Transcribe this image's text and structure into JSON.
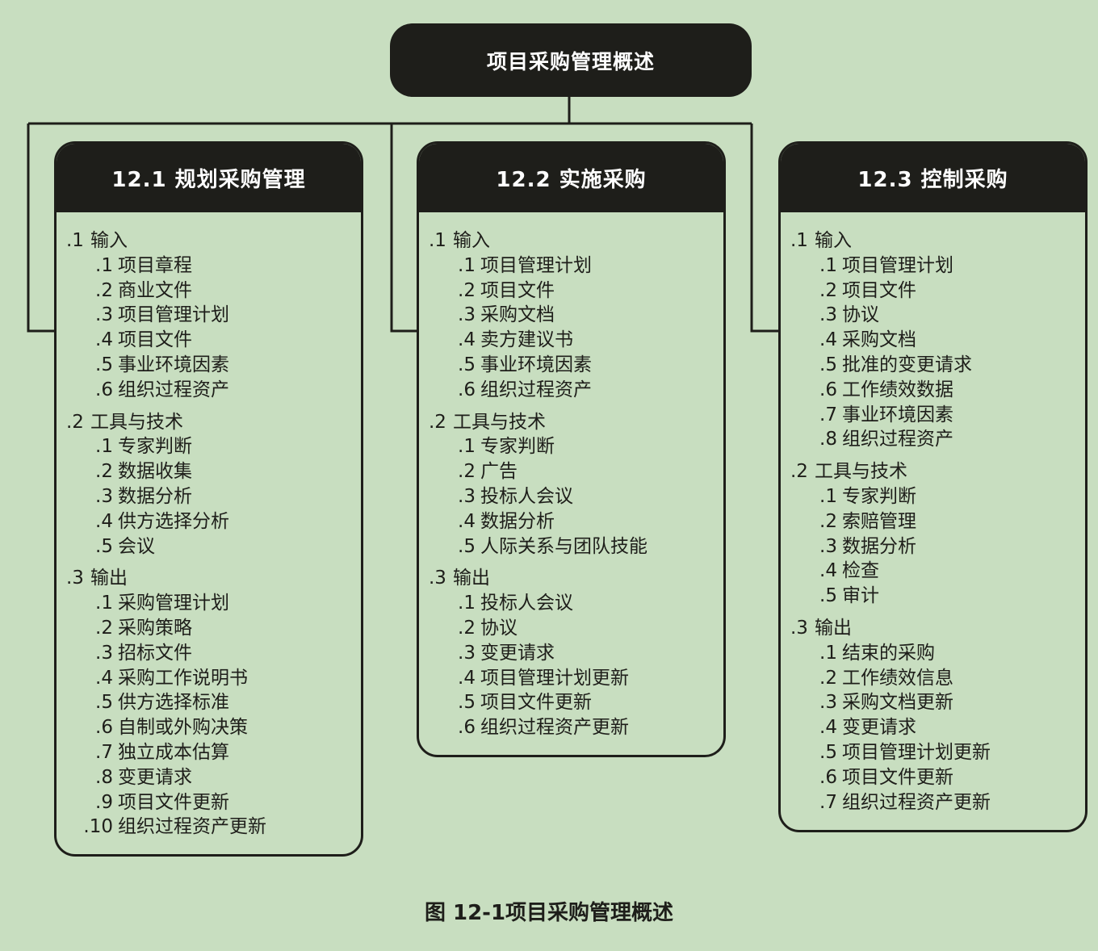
{
  "overview_title": "项目采购管理概述",
  "caption": "图 12-1项目采购管理概述",
  "processes": [
    {
      "title": "12.1 规划采购管理",
      "groups": [
        {
          "num": ".1",
          "label": "输入",
          "items": [
            {
              "num": ".1",
              "label": "项目章程"
            },
            {
              "num": ".2",
              "label": "商业文件"
            },
            {
              "num": ".3",
              "label": "项目管理计划"
            },
            {
              "num": ".4",
              "label": "项目文件"
            },
            {
              "num": ".5",
              "label": "事业环境因素"
            },
            {
              "num": ".6",
              "label": "组织过程资产"
            }
          ]
        },
        {
          "num": ".2",
          "label": "工具与技术",
          "items": [
            {
              "num": ".1",
              "label": "专家判断"
            },
            {
              "num": ".2",
              "label": "数据收集"
            },
            {
              "num": ".3",
              "label": "数据分析"
            },
            {
              "num": ".4",
              "label": "供方选择分析"
            },
            {
              "num": ".5",
              "label": "会议"
            }
          ]
        },
        {
          "num": ".3",
          "label": "输出",
          "items": [
            {
              "num": ".1",
              "label": "采购管理计划"
            },
            {
              "num": ".2",
              "label": "采购策略"
            },
            {
              "num": ".3",
              "label": "招标文件"
            },
            {
              "num": ".4",
              "label": "采购工作说明书"
            },
            {
              "num": ".5",
              "label": "供方选择标准"
            },
            {
              "num": ".6",
              "label": "自制或外购决策"
            },
            {
              "num": ".7",
              "label": "独立成本估算"
            },
            {
              "num": ".8",
              "label": "变更请求"
            },
            {
              "num": ".9",
              "label": "项目文件更新"
            },
            {
              "num": ".10",
              "label": "组织过程资产更新"
            }
          ]
        }
      ]
    },
    {
      "title": "12.2 实施采购",
      "groups": [
        {
          "num": ".1",
          "label": "输入",
          "items": [
            {
              "num": ".1",
              "label": "项目管理计划"
            },
            {
              "num": ".2",
              "label": "项目文件"
            },
            {
              "num": ".3",
              "label": "采购文档"
            },
            {
              "num": ".4",
              "label": "卖方建议书"
            },
            {
              "num": ".5",
              "label": "事业环境因素"
            },
            {
              "num": ".6",
              "label": "组织过程资产"
            }
          ]
        },
        {
          "num": ".2",
          "label": "工具与技术",
          "items": [
            {
              "num": ".1",
              "label": "专家判断"
            },
            {
              "num": ".2",
              "label": "广告"
            },
            {
              "num": ".3",
              "label": "投标人会议"
            },
            {
              "num": ".4",
              "label": "数据分析"
            },
            {
              "num": ".5",
              "label": "人际关系与团队技能"
            }
          ]
        },
        {
          "num": ".3",
          "label": "输出",
          "items": [
            {
              "num": ".1",
              "label": "投标人会议"
            },
            {
              "num": ".2",
              "label": "协议"
            },
            {
              "num": ".3",
              "label": "变更请求"
            },
            {
              "num": ".4",
              "label": "项目管理计划更新"
            },
            {
              "num": ".5",
              "label": "项目文件更新"
            },
            {
              "num": ".6",
              "label": "组织过程资产更新"
            }
          ]
        }
      ]
    },
    {
      "title": "12.3 控制采购",
      "groups": [
        {
          "num": ".1",
          "label": "输入",
          "items": [
            {
              "num": ".1",
              "label": "项目管理计划"
            },
            {
              "num": ".2",
              "label": "项目文件"
            },
            {
              "num": ".3",
              "label": "协议"
            },
            {
              "num": ".4",
              "label": "采购文档"
            },
            {
              "num": ".5",
              "label": "批准的变更请求"
            },
            {
              "num": ".6",
              "label": "工作绩效数据"
            },
            {
              "num": ".7",
              "label": "事业环境因素"
            },
            {
              "num": ".8",
              "label": "组织过程资产"
            }
          ]
        },
        {
          "num": ".2",
          "label": "工具与技术",
          "items": [
            {
              "num": ".1",
              "label": "专家判断"
            },
            {
              "num": ".2",
              "label": "索赔管理"
            },
            {
              "num": ".3",
              "label": "数据分析"
            },
            {
              "num": ".4",
              "label": "检查"
            },
            {
              "num": ".5",
              "label": "审计"
            }
          ]
        },
        {
          "num": ".3",
          "label": "输出",
          "items": [
            {
              "num": ".1",
              "label": "结束的采购"
            },
            {
              "num": ".2",
              "label": "工作绩效信息"
            },
            {
              "num": ".3",
              "label": "采购文档更新"
            },
            {
              "num": ".4",
              "label": "变更请求"
            },
            {
              "num": ".5",
              "label": "项目管理计划更新"
            },
            {
              "num": ".6",
              "label": "项目文件更新"
            },
            {
              "num": ".7",
              "label": "组织过程资产更新"
            }
          ]
        }
      ]
    }
  ]
}
